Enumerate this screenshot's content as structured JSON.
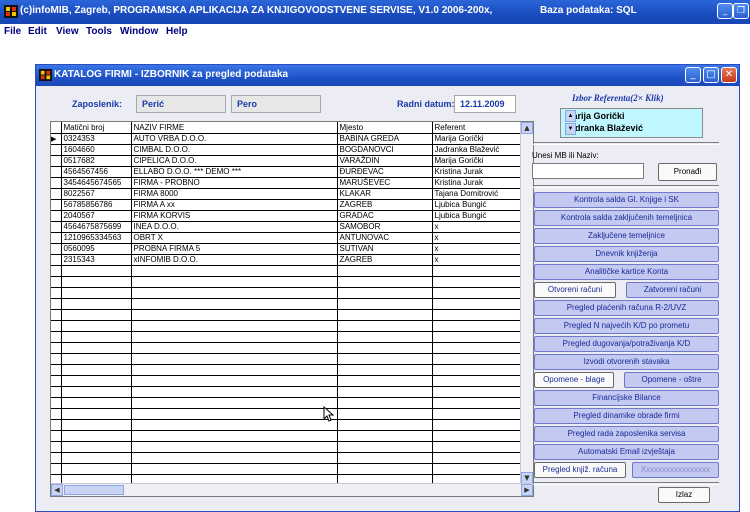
{
  "app": {
    "title": "(c)infoMIB, Zagreb, PROGRAMSKA APLIKACIJA ZA KNJIGOVODSTVENE SERVISE, V1.0 2006-200x,",
    "database": "Baza podataka: SQL"
  },
  "menu": [
    "File",
    "Edit",
    "View",
    "Tools",
    "Window",
    "Help"
  ],
  "window": {
    "title": "KATALOG FIRMI - IZBORNIK za pregled podataka"
  },
  "header": {
    "employee_label": "Zaposlenik:",
    "employee_surname": "Perić",
    "employee_name": "Pero",
    "date_label": "Radni datum:",
    "date_value": "12.11.2009"
  },
  "grid": {
    "columns": [
      "Matični broj",
      "NAZIV FIRME",
      "Mjesto",
      "Referent"
    ],
    "rows": [
      [
        "0324353",
        "AUTO VRBA D.O.O.",
        "BABINA GREDA",
        "Marija Gorički"
      ],
      [
        "1604660",
        "CIMBAL D.O.O.",
        "BOGDANOVCI",
        "Jadranka Blažević"
      ],
      [
        "0517682",
        "CIPELICA D.O.O.",
        "VARAŽDIN",
        "Marija Gorički"
      ],
      [
        "4564567456",
        "ELLABO D.O.O.   *** DEMO ***",
        "ĐURĐEVAC",
        "Kristina Jurak"
      ],
      [
        "3454645674565",
        "FIRMA - PROBNO",
        "MARUŠEVEC",
        "Kristina Jurak"
      ],
      [
        "8022567",
        "FIRMA 8000",
        "KLAKAR",
        "Tajana Domitrović"
      ],
      [
        "56785856786",
        "FIRMA A  xx",
        "ZAGREB",
        "Ljubica Bungić"
      ],
      [
        "2040567",
        "FIRMA KORVIS",
        "GRADAC",
        "Ljubica Bungić"
      ],
      [
        "4564675875699",
        "INEA D.O.O.",
        "SAMOBOR",
        "x"
      ],
      [
        "1210965334563",
        "OBRT X",
        "ANTUNOVAC",
        "x"
      ],
      [
        "0560095",
        "PROBNA FIRMA 5",
        "SUTIVAN",
        "x"
      ],
      [
        "2315343",
        "xINFOMIB D.O.O.",
        "ZAGREB",
        "x"
      ]
    ],
    "selected_indicator": "▶"
  },
  "referent": {
    "title": "Izbor Referenta(2× Klik)",
    "items": [
      "Marija Gorički",
      "Jadranka Blažević"
    ]
  },
  "search": {
    "label": "Unesi MB ili Naziv:",
    "value": "",
    "button": "Pronađi"
  },
  "buttons": {
    "kontrola_salda": "Kontrola salda Gl. Knjige i SK",
    "kontrola_temeljnica": "Kontrola salda zaključenih temeljnica",
    "zakljucene": "Zaključene temeljnice",
    "dnevnik": "Dnevnik knjiženja",
    "analiticke": "Analitičke kartice Konta",
    "otvoreni": "Otvoreni računi",
    "zatvoreni": "Zatvoreni računi",
    "placeni": "Pregled plaćenih računa R-2/UVZ",
    "najveci": "Pregled N najvećih K/D po prometu",
    "dugovanja": "Pregled dugovanja/potraživanja K/D",
    "izvodi": "Izvodi otvorenih stavaka",
    "opomene_blage": "Opomene - blage",
    "opomene_ostre": "Opomene - oštre",
    "financijske": "Financijske Bilance",
    "dinamika": "Pregled dinamike obrade firmi",
    "rad_zaposlenika": "Pregled rada zaposlenika servisa",
    "email": "Automatski Email izvještaja",
    "knjizenih": "Pregled knjiž. računa",
    "xxx": "Xxxxxxxxxxxxxxxxx",
    "izlaz": "Izlaz"
  }
}
